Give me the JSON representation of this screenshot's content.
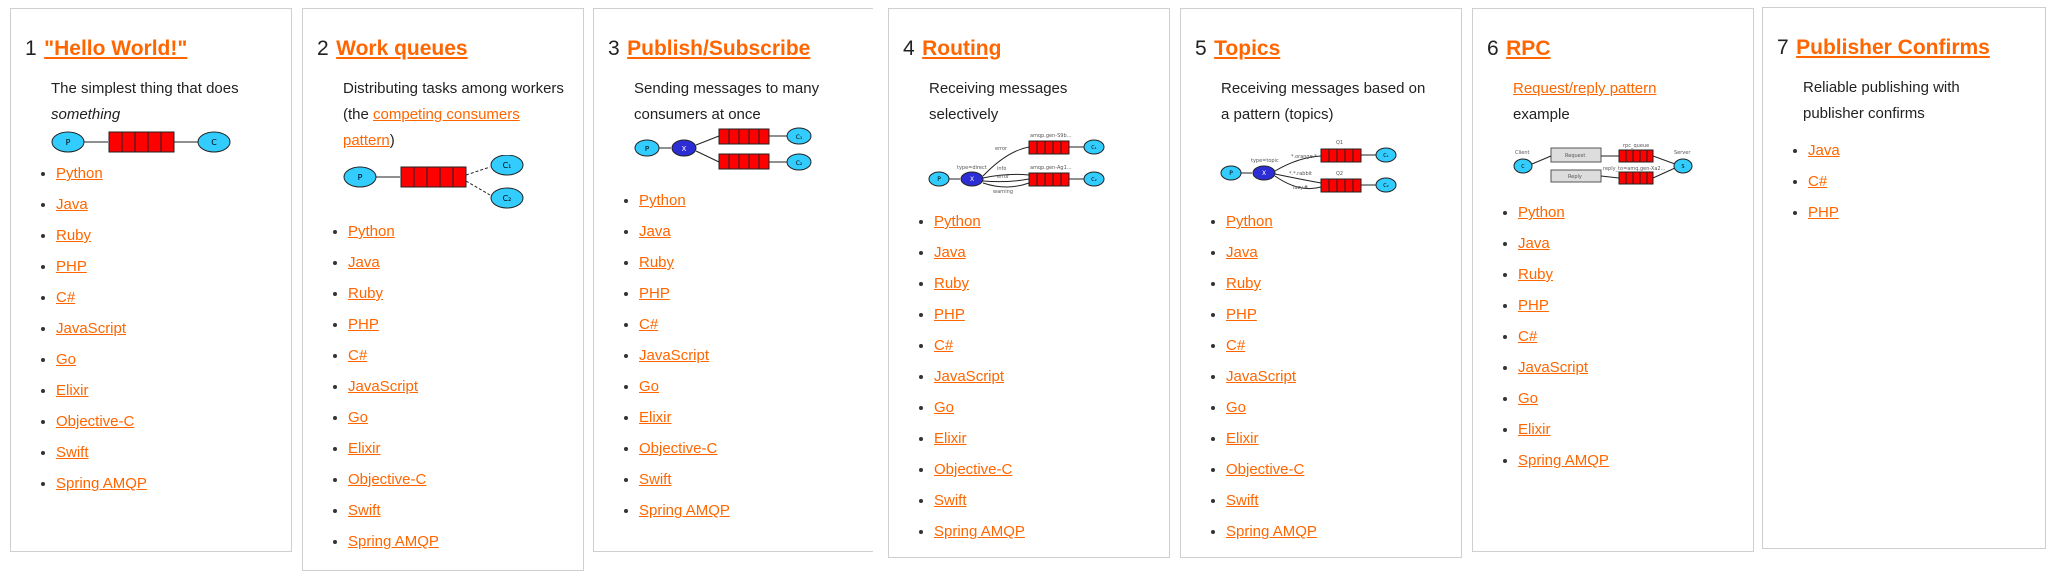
{
  "tutorials": [
    {
      "number": "1",
      "title": "\"Hello World!\"",
      "desc_plain": "The simplest thing that does",
      "desc_em": "something",
      "langs": [
        "Python",
        "Java",
        "Ruby",
        "PHP",
        "C#",
        "JavaScript",
        "Go",
        "Elixir",
        "Objective-C",
        "Swift",
        "Spring AMQP"
      ]
    },
    {
      "number": "2",
      "title": "Work queues",
      "desc_plain": "Distributing tasks among workers (the",
      "desc_link": "competing consumers pattern",
      "desc_end": ")",
      "langs": [
        "Python",
        "Java",
        "Ruby",
        "PHP",
        "C#",
        "JavaScript",
        "Go",
        "Elixir",
        "Objective-C",
        "Swift",
        "Spring AMQP"
      ]
    },
    {
      "number": "3",
      "title": "Publish/Subscribe",
      "desc_plain": "Sending messages to many consumers at once",
      "langs": [
        "Python",
        "Java",
        "Ruby",
        "PHP",
        "C#",
        "JavaScript",
        "Go",
        "Elixir",
        "Objective-C",
        "Swift",
        "Spring AMQP"
      ]
    },
    {
      "number": "4",
      "title": "Routing",
      "desc_plain": "Receiving messages selectively",
      "langs": [
        "Python",
        "Java",
        "Ruby",
        "PHP",
        "C#",
        "JavaScript",
        "Go",
        "Elixir",
        "Objective-C",
        "Swift",
        "Spring AMQP"
      ]
    },
    {
      "number": "5",
      "title": "Topics",
      "desc_plain": "Receiving messages based on a pattern (topics)",
      "langs": [
        "Python",
        "Java",
        "Ruby",
        "PHP",
        "C#",
        "JavaScript",
        "Go",
        "Elixir",
        "Objective-C",
        "Swift",
        "Spring AMQP"
      ]
    },
    {
      "number": "6",
      "title": "RPC",
      "desc_link": "Request/reply pattern",
      "desc_end": "example",
      "langs": [
        "Python",
        "Java",
        "Ruby",
        "PHP",
        "C#",
        "JavaScript",
        "Go",
        "Elixir",
        "Spring AMQP"
      ]
    },
    {
      "number": "7",
      "title": "Publisher Confirms",
      "desc_plain": "Reliable publishing with publisher confirms",
      "langs": [
        "Java",
        "C#",
        "PHP"
      ]
    }
  ],
  "diagram_labels": {
    "producer": "P",
    "consumer": "C",
    "c1": "C₁",
    "c2": "C₂",
    "t4_type": "type=direct",
    "t4_r1": "error",
    "t4_r2": "info",
    "t4_r3": "error",
    "t4_r4": "warning",
    "t4_q1": "amqp.gen-S9b...",
    "t4_q2": "amqp.gen-Ag1...",
    "t5_type": "type=topic",
    "t5_r1": "*.orange.*",
    "t5_r2": "*.*.rabbit",
    "t5_r3": "lazy.#",
    "t5_q1": "Q1",
    "t5_q2": "Q2",
    "t6_client": "Client",
    "t6_server": "Server",
    "t6_req": "Request",
    "t6_rep": "Reply",
    "t6_rpc_queue": "rpc_queue",
    "t6_reply_to": "reply_to=amq.gen-Xa2..."
  },
  "colors": {
    "accent": "#ff6600",
    "queue": "#ff0000",
    "node": "#33ccff",
    "exchange": "#2d2dd6"
  }
}
